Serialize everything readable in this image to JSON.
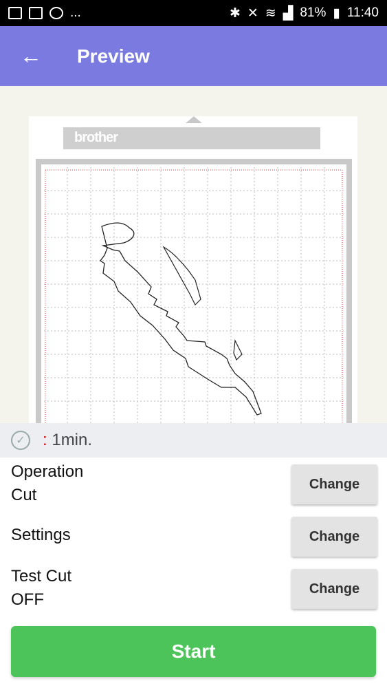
{
  "status_bar": {
    "battery": "81%",
    "time": "11:40",
    "left_more": "..."
  },
  "app_bar": {
    "back_icon": "arrow-left-icon",
    "title": "Preview"
  },
  "mat": {
    "brand": "brother"
  },
  "estimate": {
    "colon": ":",
    "value": "1min."
  },
  "options": [
    {
      "label": "Operation",
      "value": "Cut",
      "button": "Change"
    },
    {
      "label": "Settings",
      "value": "",
      "button": "Change"
    },
    {
      "label": "Test Cut",
      "value": "OFF",
      "button": "Change"
    }
  ],
  "start_button": "Start",
  "colors": {
    "app_bar": "#7b7ae0",
    "start": "#4dc45a",
    "cut_area_border": "#e03a3a"
  }
}
